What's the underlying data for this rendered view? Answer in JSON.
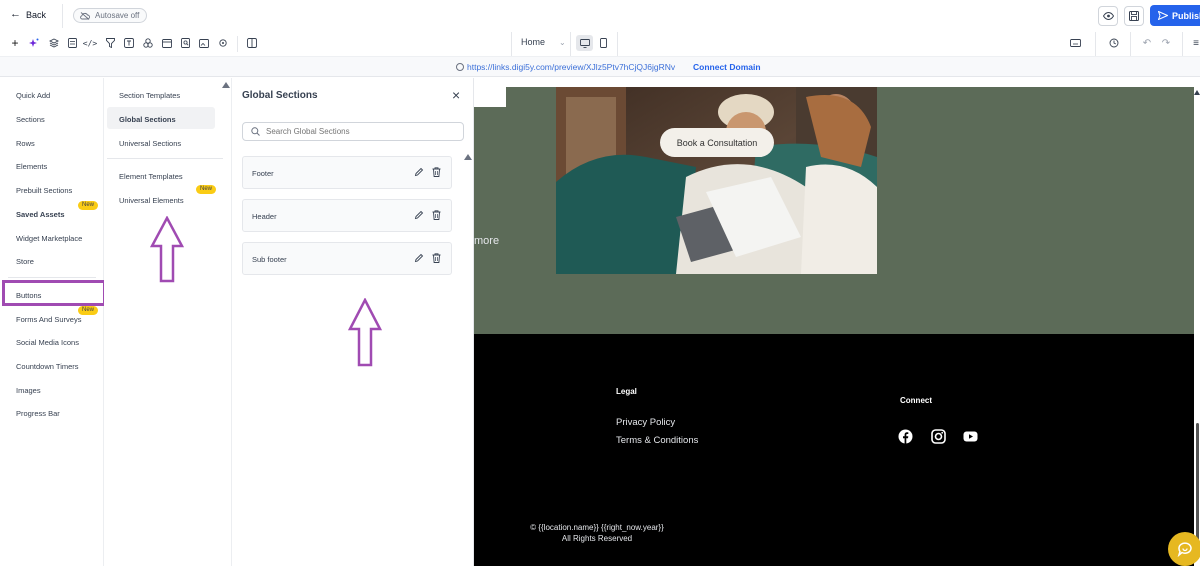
{
  "topbar": {
    "back_label": "Back",
    "autosave_label": "Autosave off",
    "publish_label": "Publish"
  },
  "toolbar": {
    "page_label": "Home"
  },
  "urlbar": {
    "url": "https://links.digi5y.com/preview/XJlz5Ptv7hCjQJ6jgRNv",
    "connect_domain": "Connect Domain"
  },
  "left_panel": {
    "items": [
      {
        "label": "Quick Add"
      },
      {
        "label": "Sections"
      },
      {
        "label": "Rows"
      },
      {
        "label": "Elements"
      },
      {
        "label": "Prebuilt Sections"
      },
      {
        "label": "Saved Assets",
        "badge": "New"
      },
      {
        "label": "Widget Marketplace"
      },
      {
        "label": "Store"
      },
      {
        "label": "Buttons"
      },
      {
        "label": "Forms And Surveys",
        "badge": "New"
      },
      {
        "label": "Social Media Icons"
      },
      {
        "label": "Countdown Timers"
      },
      {
        "label": "Images"
      },
      {
        "label": "Progress Bar"
      }
    ]
  },
  "mid_panel": {
    "items": [
      {
        "label": "Section Templates"
      },
      {
        "label": "Global Sections"
      },
      {
        "label": "Universal Sections"
      },
      {
        "label": "Element Templates"
      },
      {
        "label": "Universal Elements",
        "badge": "New"
      }
    ]
  },
  "global_sections": {
    "title": "Global Sections",
    "search_placeholder": "Search Global Sections",
    "sections": [
      {
        "name": "Footer"
      },
      {
        "name": "Header"
      },
      {
        "name": "Sub footer"
      }
    ]
  },
  "canvas": {
    "partial_text": "more",
    "cta_label": "Book a Consultation",
    "footer": {
      "legal_heading": "Legal",
      "privacy_link": "Privacy Policy",
      "terms_link": "Terms & Conditions",
      "connect_heading": "Connect",
      "copyright_line1": "© {{location.name}} {{right_now.year}}",
      "copyright_line2": "All Rights Reserved"
    }
  },
  "colors": {
    "accent": "#2563eb",
    "highlight": "#a04bb2",
    "badge": "#facc15",
    "hero_green": "#5c6b58",
    "footer_bg": "#000000"
  }
}
